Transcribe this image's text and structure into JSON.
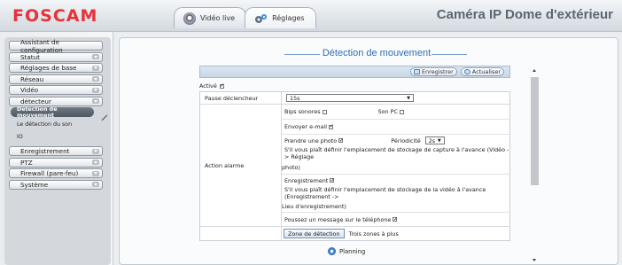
{
  "header": {
    "logo": "FOSCAM",
    "tabs": [
      {
        "label": "Vidéo live",
        "icon": "camera-icon"
      },
      {
        "label": "Réglages",
        "icon": "gear-icon"
      }
    ],
    "title": "Caméra IP Dome d'extérieur"
  },
  "sidebar": {
    "items": [
      {
        "label": "Assistant de configuration"
      },
      {
        "label": "Statut"
      },
      {
        "label": "Réglages de base"
      },
      {
        "label": "Réseau"
      },
      {
        "label": "Vidéo"
      },
      {
        "label": "détecteur"
      },
      {
        "label": "Enregistrement"
      },
      {
        "label": "PTZ"
      },
      {
        "label": "Firewall (pare-feu)"
      },
      {
        "label": "Système"
      }
    ],
    "submenu": [
      {
        "label": "Détection de mouvement"
      },
      {
        "label": "Le détection du son"
      },
      {
        "label": "IO"
      }
    ]
  },
  "main": {
    "section_title": "Détection de mouvement",
    "toolbar": {
      "save_label": "Enregistrer",
      "refresh_label": "Actualiser"
    },
    "active_label": "Activé",
    "pause_label": "Pause déclencheur",
    "pause_value": "15s",
    "action_label": "Action alarme",
    "beep_label": "Bips sonores",
    "pc_sound_label": "Son PC",
    "email_label": "Envoyer e-mail",
    "photo_label": "Prendre une photo",
    "period_label": "Périodicité",
    "period_value": "2s",
    "photo_note": "S'il vous plaît définir l'emplacement de stockage de capture à l'avance (Vidéo -> Réglage",
    "photo_note_2": "photo)",
    "record_label": "Enregistrement",
    "record_note": "S'il vous plaît définir l'emplacement de stockage de la vidéo à l'avance (Enregistrement ->",
    "record_note_2": "Lieu d'enregistrement)",
    "push_label": "Poussez un message sur le téléphone",
    "zone_button": "Zone de détection",
    "zone_text": "Trois zones à plus",
    "planning_label": "Planning"
  }
}
